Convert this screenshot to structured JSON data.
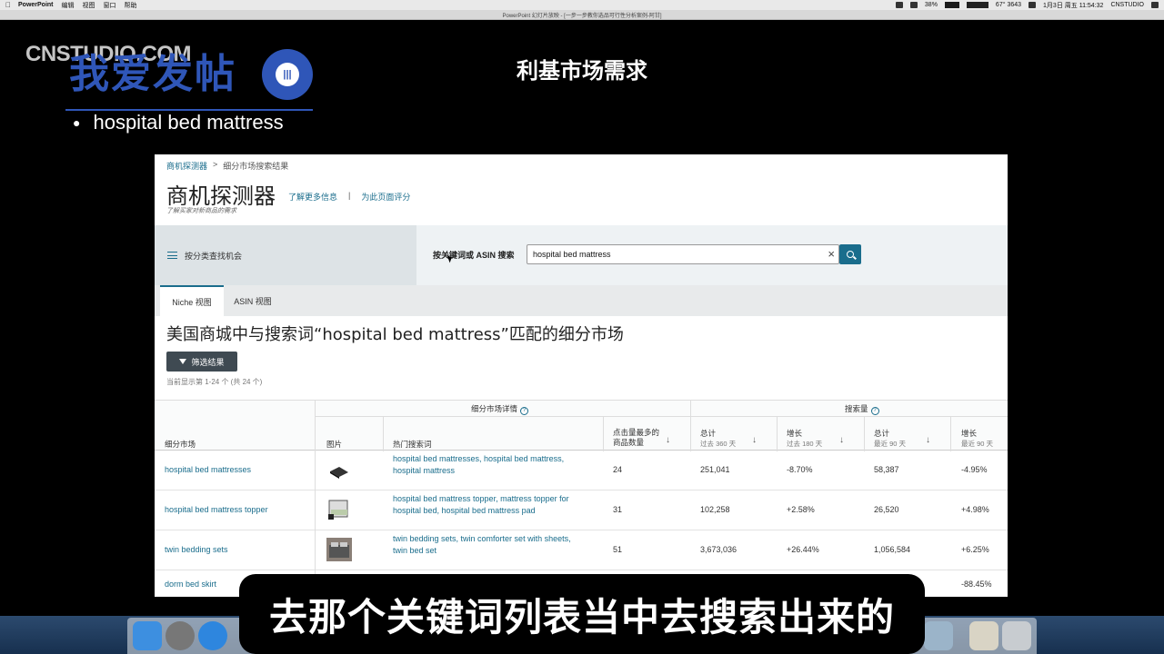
{
  "menubar": {
    "app": "PowerPoint",
    "items": [
      "编辑",
      "视图",
      "窗口",
      "帮助"
    ],
    "battery": "38%",
    "temp": "67° 3643",
    "datetime": "1月3日 周五 11:54:32",
    "user": "CNSTUDIO"
  },
  "window_title": "PowerPoint 幻灯片放映 - [一步一步教你选品可行性分析案例-阿甘]",
  "overlay": {
    "watermark": "CNSTUDIO.COM",
    "logo_text": "我爱发帖",
    "bullet": "hospital bed mattress",
    "slide_title": "利基市场需求",
    "caption": "去那个关键词列表当中去搜索出来的"
  },
  "page": {
    "breadcrumb_root": "商机探测器",
    "breadcrumb_sep": ">",
    "breadcrumb_current": "细分市场搜索结果",
    "heading": "商机探测器",
    "learn_more": "了解更多信息",
    "pipe": "|",
    "rate_page": "为此页面评分",
    "subheading": "了解买家对新商品的需求",
    "browse_by_category": "按分类查找机会",
    "search_label": "按关键词或 ASIN 搜索",
    "search_value": "hospital bed mattress",
    "clear_icon": "×",
    "tab_niche": "Niche 视图",
    "tab_asin": "ASIN 视图",
    "results_title": "美国商城中与搜索词“hospital bed mattress”匹配的细分市场",
    "filter_button": "筛选结果",
    "results_count": "当前显示第 1-24 个 (共 24 个)"
  },
  "table": {
    "group_details": "细分市场详情",
    "group_search": "搜索量",
    "col_niche": "细分市场",
    "col_image": "图片",
    "col_keywords": "热门搜索词",
    "col_products": "点击量最多的商品数量",
    "col_total_360": "总计",
    "col_total_360_sub": "过去 360 天",
    "col_growth_180": "增长",
    "col_growth_180_sub": "过去 180 天",
    "col_total_90": "总计",
    "col_total_90_sub": "最近 90 天",
    "col_growth_90": "增长",
    "col_growth_90_sub": "最近 90 天",
    "rows": [
      {
        "niche": "hospital bed mattresses",
        "kw1": "hospital bed mattresses, hospital bed mattress,",
        "kw2": "hospital mattress",
        "products": "24",
        "total360": "251,041",
        "growth180": "-8.70%",
        "total90": "58,387",
        "growth90": "-4.95%"
      },
      {
        "niche": "hospital bed mattress topper",
        "kw1": "hospital bed mattress topper, mattress topper for",
        "kw2": "hospital bed, hospital bed mattress pad",
        "products": "31",
        "total360": "102,258",
        "growth180": "+2.58%",
        "total90": "26,520",
        "growth90": "+4.98%"
      },
      {
        "niche": "twin bedding sets",
        "kw1": "twin bedding sets, twin comforter set with sheets,",
        "kw2": "twin bed set",
        "products": "51",
        "total360": "3,673,036",
        "growth180": "+26.44%",
        "total90": "1,056,584",
        "growth90": "+6.25%"
      },
      {
        "niche": "dorm bed skirt",
        "kw1": "",
        "kw2": "",
        "products": "",
        "total360": "",
        "growth180": "",
        "total90": "",
        "growth90": "-88.45%"
      }
    ]
  },
  "colors": {
    "link": "#1a6d8c",
    "logo_blue": "#2f56b8",
    "filter_btn": "#3f4a52"
  }
}
